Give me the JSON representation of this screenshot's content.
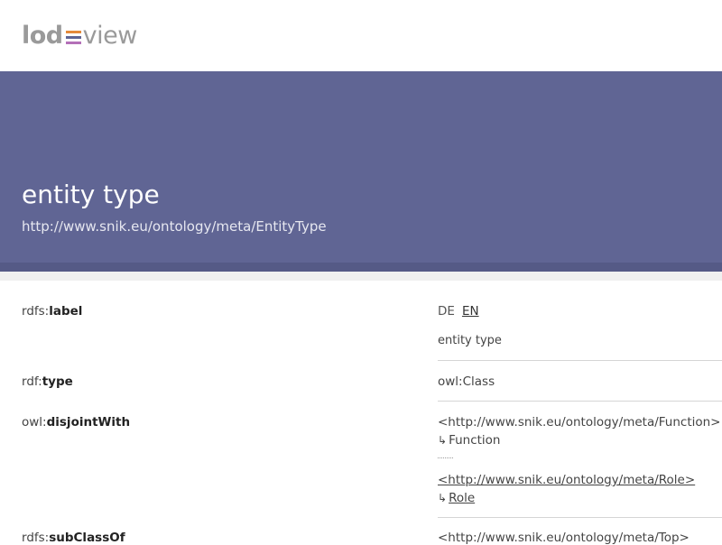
{
  "logo": {
    "part1": "lod",
    "part2": "view"
  },
  "hero": {
    "title": "entity type",
    "uri": "http://www.snik.eu/ontology/meta/EntityType"
  },
  "properties": {
    "label": {
      "prefix": "rdfs:",
      "name": "label",
      "languages": [
        "DE",
        "EN"
      ],
      "active_language": "EN",
      "value": "entity type"
    },
    "type": {
      "prefix": "rdf:",
      "name": "type",
      "value": "owl:Class"
    },
    "disjointWith": {
      "prefix": "owl:",
      "name": "disjointWith",
      "items": [
        {
          "uri": "<http://www.snik.eu/ontology/meta/Function>",
          "label": "Function"
        },
        {
          "uri": "<http://www.snik.eu/ontology/meta/Role>",
          "label": "Role"
        }
      ]
    },
    "subClassOf": {
      "prefix": "rdfs:",
      "name": "subClassOf",
      "value": "<http://www.snik.eu/ontology/meta/Top>"
    }
  },
  "icons": {
    "arrow": "↳"
  },
  "colors": {
    "hero_bg": "#606594",
    "logo_orange": "#e58a3a",
    "logo_navy": "#5f6494",
    "logo_purple": "#b470b8"
  }
}
